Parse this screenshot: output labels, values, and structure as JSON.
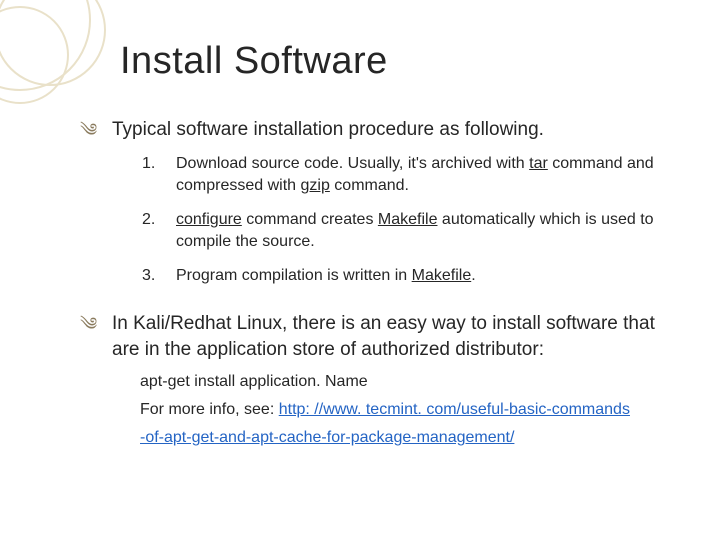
{
  "title": "Install Software",
  "bullets": [
    {
      "lead": "Typical software installation procedure as following.",
      "items": [
        {
          "num": "1.",
          "pre": "Download source code. Usually, it's archived with ",
          "u1": "tar",
          "mid": " command and compressed with ",
          "u2": "gzip",
          "post": " command."
        },
        {
          "num": "2.",
          "u1": "configure",
          "mid": " command creates ",
          "u2": "Makefile",
          "post": " automatically which is used to compile the source."
        },
        {
          "num": "3.",
          "pre": "Program compilation is written in ",
          "u1": "Makefile",
          "post": "."
        }
      ]
    },
    {
      "lead": "In Kali/Redhat Linux, there is  an easy way to install software that are in the application store of authorized distributor:",
      "sub": {
        "cmd": "apt-get install application. Name",
        "info_pre": "For more info, see: ",
        "link1": "http: //www. tecmint. com/useful-basic-commands",
        "link2": "-of-apt-get-and-apt-cache-for-package-management/"
      }
    }
  ]
}
